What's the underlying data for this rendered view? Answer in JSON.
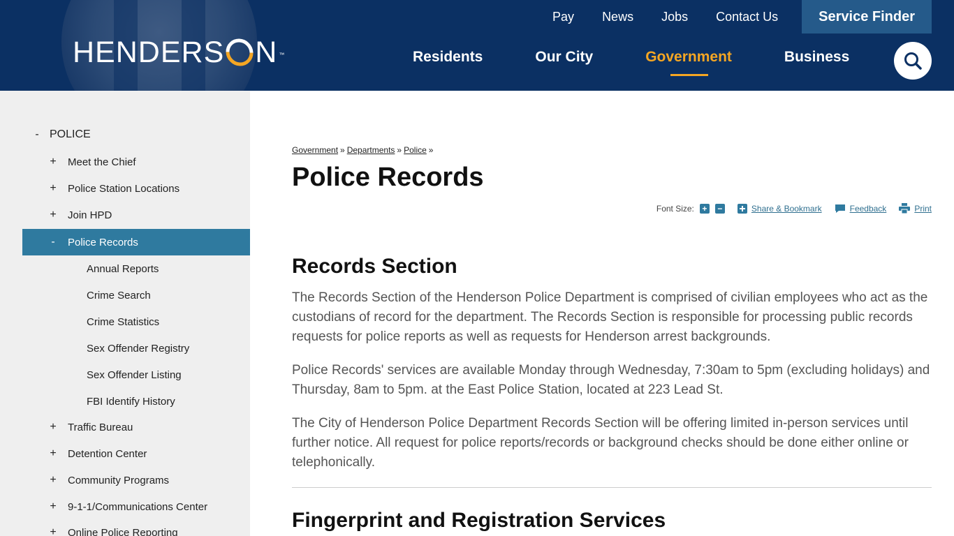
{
  "header": {
    "logo_text_before": "HENDERS",
    "logo_text_after": "N",
    "logo_tm": "™",
    "util_links": [
      "Pay",
      "News",
      "Jobs",
      "Contact Us"
    ],
    "service_finder": "Service Finder",
    "main_links": [
      "Residents",
      "Our City",
      "Government",
      "Business"
    ],
    "active_main": "Government",
    "colors": {
      "navy": "#0b3063",
      "accent": "#f5a623",
      "teal": "#2f7a9f"
    }
  },
  "sidebar": {
    "items": [
      {
        "sign": "-",
        "label": "POLICE",
        "level": 0
      },
      {
        "sign": "+",
        "label": "Meet the Chief",
        "level": 1
      },
      {
        "sign": "+",
        "label": "Police Station Locations",
        "level": 1
      },
      {
        "sign": "+",
        "label": "Join HPD",
        "level": 1
      },
      {
        "sign": "-",
        "label": "Police Records",
        "level": 1,
        "active": true
      },
      {
        "sign": "",
        "label": "Annual Reports",
        "level": 2
      },
      {
        "sign": "",
        "label": "Crime Search",
        "level": 2
      },
      {
        "sign": "",
        "label": "Crime Statistics",
        "level": 2
      },
      {
        "sign": "",
        "label": "Sex Offender Registry",
        "level": 2
      },
      {
        "sign": "",
        "label": "Sex Offender Listing",
        "level": 2
      },
      {
        "sign": "",
        "label": "FBI Identify History",
        "level": 2
      },
      {
        "sign": "+",
        "label": "Traffic Bureau",
        "level": 1
      },
      {
        "sign": "+",
        "label": "Detention Center",
        "level": 1
      },
      {
        "sign": "+",
        "label": "Community Programs",
        "level": 1
      },
      {
        "sign": "+",
        "label": "9-1-1/Communications Center",
        "level": 1
      },
      {
        "sign": "+",
        "label": "Online Police Reporting",
        "level": 1
      }
    ]
  },
  "breadcrumb": {
    "items": [
      "Government",
      "Departments",
      "Police"
    ],
    "separator": "»"
  },
  "page": {
    "title": "Police Records"
  },
  "tools": {
    "font_size_label": "Font Size:",
    "increase": "+",
    "decrease": "−",
    "share": "Share & Bookmark",
    "feedback": "Feedback",
    "print": "Print"
  },
  "content": {
    "section1_title": "Records Section",
    "para1": "The Records Section of the Henderson Police Department is comprised of civilian employees who act as the custodians of record for the department. The Records Section is responsible for processing public records requests for police reports as well as requests for Henderson arrest backgrounds.",
    "para2": "Police Records' services are available Monday through Wednesday, 7:30am to 5pm (excluding holidays) and Thursday, 8am to 5pm. at the East Police Station, located at 223 Lead St.",
    "para3": "The City of Henderson Police Department Records Section will be offering limited in-person services until further notice. All request for police reports/records or background checks should be done either online or telephonically.",
    "section2_title": "Fingerprint and Registration Services"
  }
}
